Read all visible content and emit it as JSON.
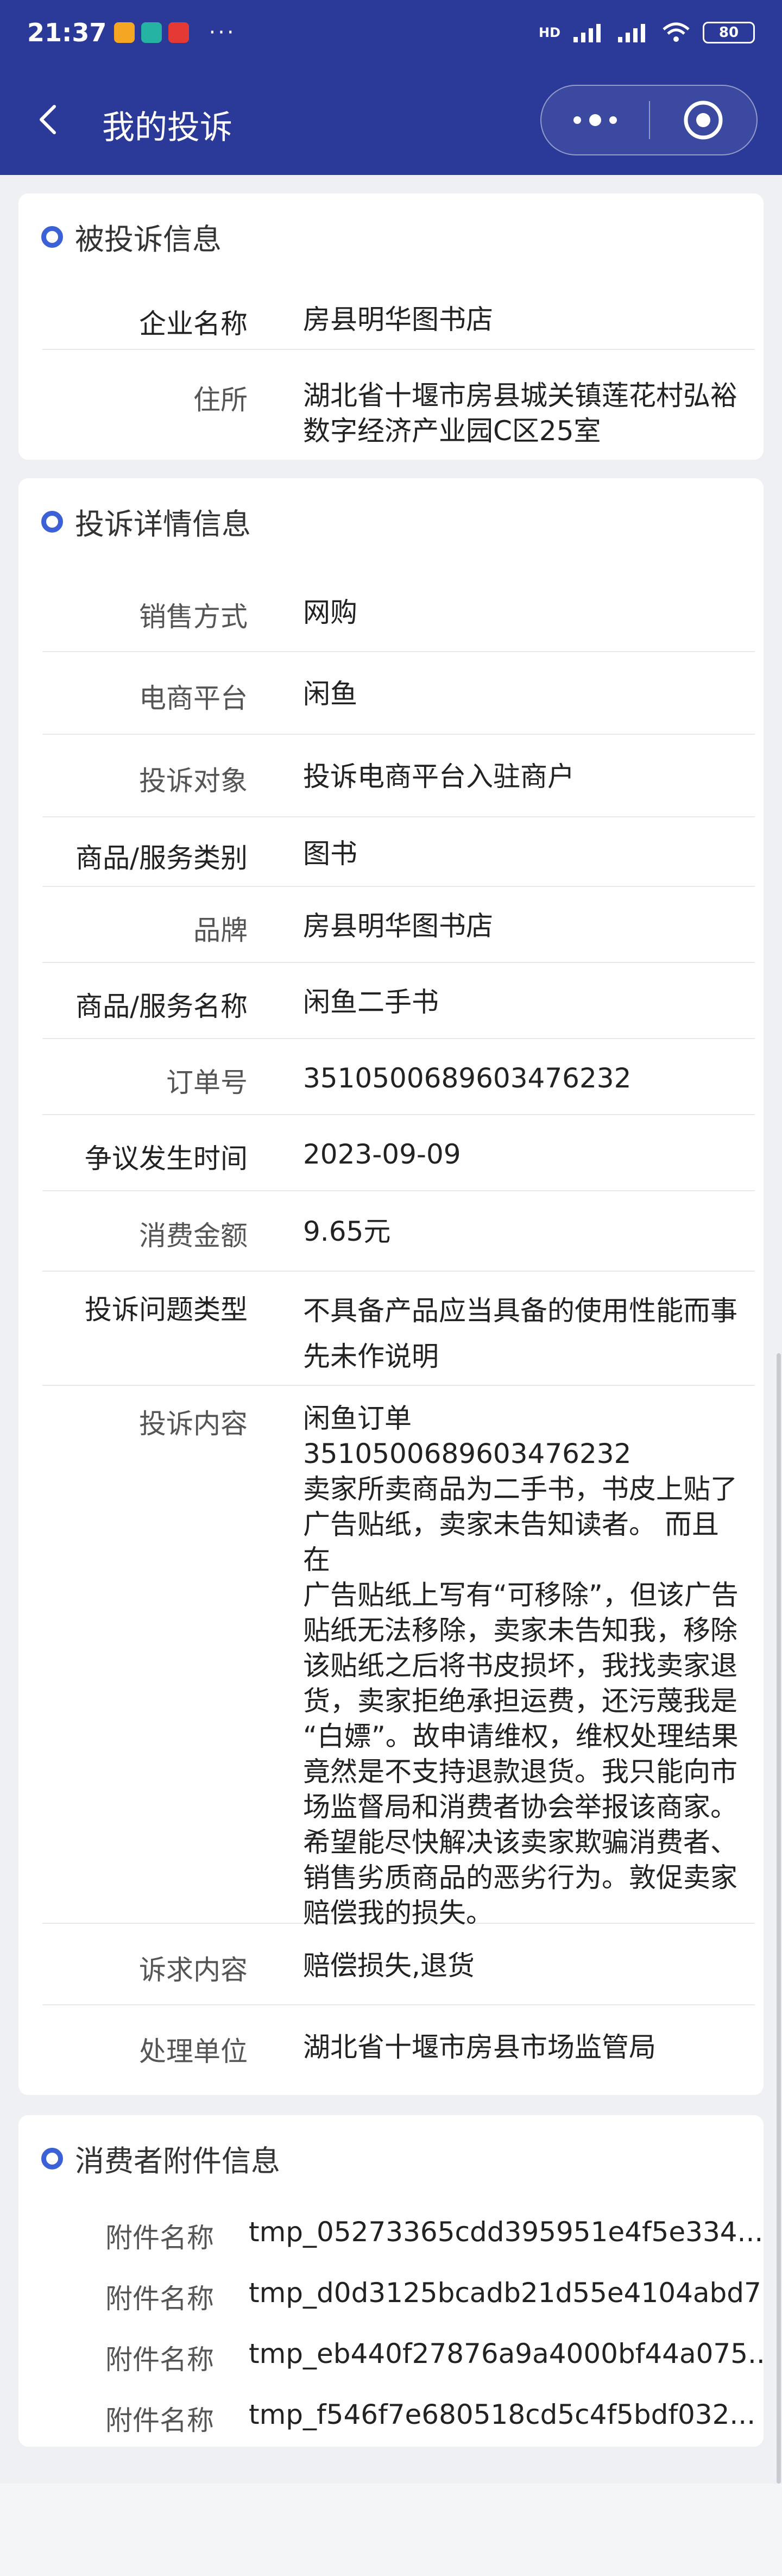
{
  "status_bar": {
    "time": "21:37",
    "more": "···",
    "network": "HD",
    "battery": "80"
  },
  "nav": {
    "title": "我的投诉"
  },
  "complained": {
    "section_title": "被投诉信息",
    "rows": [
      {
        "label": "企业名称",
        "value": "房县明华图书店"
      },
      {
        "label": "住所",
        "value": "湖北省十堰市房县城关镇莲花村弘裕数字经济产业园C区25室"
      }
    ]
  },
  "details": {
    "section_title": "投诉详情信息",
    "rows": [
      {
        "label": "销售方式",
        "value": "网购"
      },
      {
        "label": "电商平台",
        "value": "闲鱼"
      },
      {
        "label": "投诉对象",
        "value": "投诉电商平台入驻商户"
      },
      {
        "label": "商品/服务类别",
        "value": "图书"
      },
      {
        "label": "品牌",
        "value": "房县明华图书店"
      },
      {
        "label": "商品/服务名称",
        "value": "闲鱼二手书"
      },
      {
        "label": "订单号",
        "value": "3510500689603476232"
      },
      {
        "label": "争议发生时间",
        "value": "2023-09-09"
      },
      {
        "label": "消费金额",
        "value": "9.65元"
      },
      {
        "label": "投诉问题类型",
        "value": "不具备产品应当具备的使用性能而事先未作说明"
      },
      {
        "label": "投诉内容",
        "value_lines": [
          "闲鱼订单",
          "3510500689603476232",
          "卖家所卖商品为二手书，书皮上贴了",
          "广告贴纸，卖家未告知读者。 而且在",
          "广告贴纸上写有“可移除”，但该广告",
          "贴纸无法移除，卖家未告知我，移除",
          "该贴纸之后将书皮损坏，我找卖家退",
          "货，卖家拒绝承担运费，还污蔑我是",
          "“白嫖”。故申请维权，维权处理结果",
          "竟然是不支持退款退货。我只能向市",
          "场监督局和消费者协会举报该商家。",
          "希望能尽快解决该卖家欺骗消费者、",
          "销售劣质商品的恶劣行为。敦促卖家",
          "赔偿我的损失。"
        ]
      },
      {
        "label": "诉求内容",
        "value": "赔偿损失,退货"
      },
      {
        "label": "处理单位",
        "value": "湖北省十堰市房县市场监管局"
      }
    ]
  },
  "attachments": {
    "section_title": "消费者附件信息",
    "items": [
      {
        "label": "附件名称",
        "value": "tmp_05273365cdd395951e4f5e334..."
      },
      {
        "label": "附件名称",
        "value": "tmp_d0d3125bcadb21d55e4104abd7..."
      },
      {
        "label": "附件名称",
        "value": "tmp_eb440f27876a9a4000bf44a075..."
      },
      {
        "label": "附件名称",
        "value": "tmp_f546f7e680518cd5c4f5bdf032..."
      }
    ]
  },
  "colors": {
    "header_bg": "#2b3a98",
    "accent": "#3c60d6"
  }
}
